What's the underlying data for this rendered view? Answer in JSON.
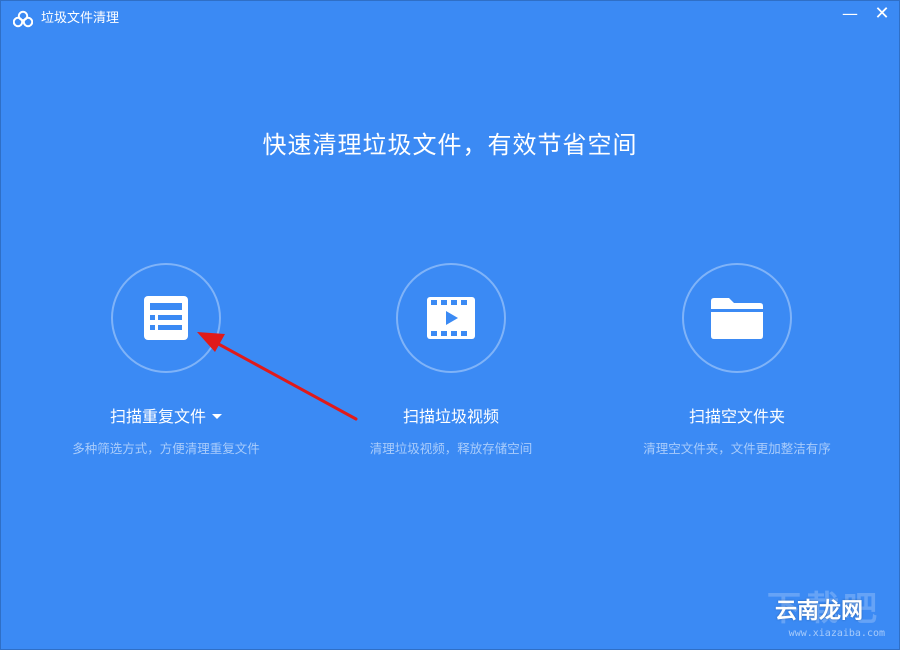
{
  "window": {
    "title": "垃圾文件清理",
    "minimize_symbol": "—",
    "close_symbol": "✕",
    "logo_icon": "cloud-icon"
  },
  "headline": "快速清理垃圾文件，有效节省空间",
  "cards": [
    {
      "icon": "document-list-icon",
      "title": "扫描重复文件",
      "has_dropdown": true,
      "desc": "多种筛选方式，方便清理重复文件"
    },
    {
      "icon": "video-film-icon",
      "title": "扫描垃圾视频",
      "has_dropdown": false,
      "desc": "清理垃圾视频，释放存储空间"
    },
    {
      "icon": "folder-icon",
      "title": "扫描空文件夹",
      "has_dropdown": false,
      "desc": "清理空文件夹，文件更加整洁有序"
    }
  ],
  "annotation": {
    "arrow_color": "#e01a1a"
  },
  "watermark": {
    "big": "下载吧",
    "cn": "云南龙网",
    "url": "www.xiazaiba.com"
  },
  "colors": {
    "background": "#3b8af4",
    "text": "#ffffff",
    "subtext": "#a9ccfb"
  }
}
